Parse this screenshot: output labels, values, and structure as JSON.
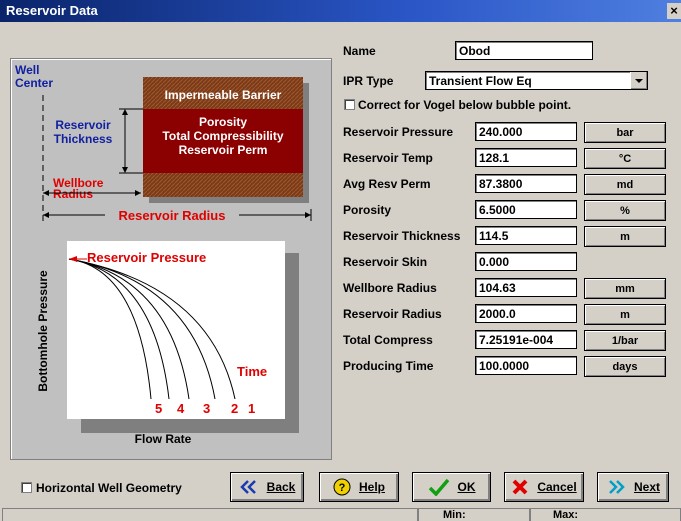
{
  "window": {
    "title": "Reservoir Data",
    "close": "×"
  },
  "diagram": {
    "well_center": "Well\nCenter",
    "impermeable_barrier": "Impermeable Barrier",
    "reservoir_props": "Porosity\nTotal Compressibility\nReservoir Perm",
    "reservoir_thickness": "Reservoir\nThickness",
    "wellbore_radius": "Wellbore\nRadius",
    "reservoir_radius": "Reservoir Radius",
    "reservoir_pressure": "Reservoir Pressure",
    "y_axis": "Bottomhole Pressure",
    "x_axis": "Flow Rate",
    "time": "Time",
    "curve_labels": [
      "5",
      "4",
      "3",
      "2",
      "1"
    ]
  },
  "form": {
    "name_label": "Name",
    "name_value": "Obod",
    "ipr_label": "IPR Type",
    "ipr_value": "Transient Flow Eq",
    "vogel_label": "Correct for Vogel below bubble point.",
    "rows": [
      {
        "label": "Reservoir Pressure",
        "value": "240.000",
        "unit": "bar"
      },
      {
        "label": "Reservoir Temp",
        "value": "128.1",
        "unit": "°C"
      },
      {
        "label": "Avg Resv Perm",
        "value": "87.3800",
        "unit": "md"
      },
      {
        "label": "Porosity",
        "value": "6.5000",
        "unit": "%"
      },
      {
        "label": "Reservoir Thickness",
        "value": "114.5",
        "unit": "m"
      },
      {
        "label": "Reservoir Skin",
        "value": "0.000",
        "unit": ""
      },
      {
        "label": "Wellbore Radius",
        "value": "104.63",
        "unit": "mm"
      },
      {
        "label": "Reservoir Radius",
        "value": "2000.0",
        "unit": "m"
      },
      {
        "label": "Total Compress",
        "value": "7.25191e-004",
        "unit": "1/bar"
      },
      {
        "label": "Producing Time",
        "value": "100.0000",
        "unit": "days"
      }
    ]
  },
  "footer": {
    "horizontal_label": "Horizontal Well Geometry",
    "back": "Back",
    "help": "Help",
    "ok": "OK",
    "cancel": "Cancel",
    "next": "Next"
  },
  "status": {
    "min": "Min:",
    "max": "Max:"
  },
  "colors": {
    "title_bar": "#0a246a",
    "barrier": "#7a3a1a",
    "reservoir": "#8b0000",
    "label_red": "#e00000",
    "label_blue": "#1020a0"
  }
}
